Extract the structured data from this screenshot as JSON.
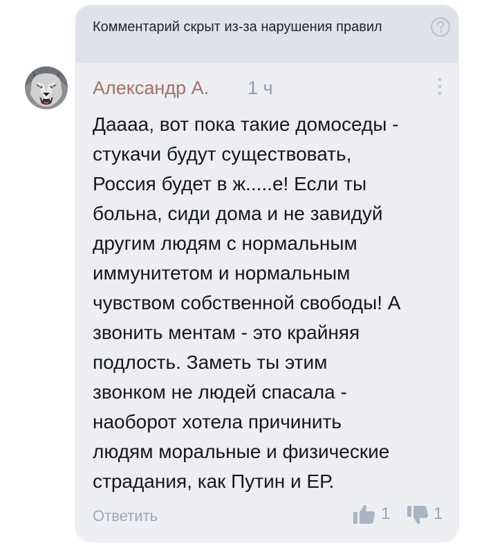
{
  "hidden_notice": {
    "text": "Комментарий скрыт из-за нарушения правил",
    "help_icon": "question-circle-icon"
  },
  "comment": {
    "author": "Александр А.",
    "time": "1 ч",
    "avatar_icon": "wolf-avatar",
    "lines": [
      "Даааа, вот пока такие домоседы -",
      "стукачи будут существовать,",
      "Россия будет в ж.....е! Если ты",
      "больна, сиди дома и не завидуй",
      "другим людям с нормальным",
      "иммунитетом и нормальным",
      "чувством собственной свободы! А",
      "звонить ментам - это крайняя",
      "подлость. Заметь ты этим",
      "звонком не людей спасала -",
      "наоборот хотела причинить",
      "людям моральные и физические",
      "страдания, как Путин и ЕР."
    ],
    "reply_label": "Ответить",
    "likes": "1",
    "dislikes": "1"
  },
  "colors": {
    "card_bg": "#eceef2",
    "notice_bg": "#dfe2e8",
    "author": "#a47068",
    "muted": "#9aa9ba",
    "text": "#16171a"
  }
}
